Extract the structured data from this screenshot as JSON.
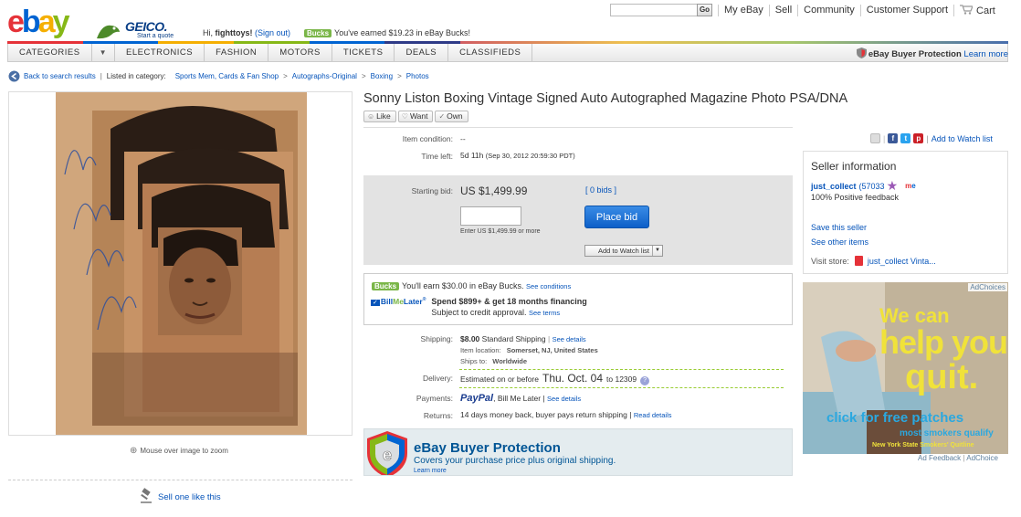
{
  "header": {
    "greeting_prefix": "Hi,",
    "username": "fighttoys!",
    "signout": "(Sign out)",
    "bucks_badge": "Bucks",
    "bucks_text": "You've earned $19.23 in eBay Bucks!",
    "geico_brand": "GEICO.",
    "geico_sub": "Start a quote",
    "go_label": "Go",
    "nav": [
      "My eBay",
      "Sell",
      "Community",
      "Customer Support",
      "Cart"
    ]
  },
  "categories": [
    "CATEGORIES",
    "ELECTRONICS",
    "FASHION",
    "MOTORS",
    "TICKETS",
    "DEALS",
    "CLASSIFIEDS"
  ],
  "protection_top": {
    "label": "eBay Buyer Protection",
    "learn": "Learn more"
  },
  "breadcrumb": {
    "back": "Back to search results",
    "listed": "Listed in category:",
    "crumbs": [
      "Sports Mem, Cards & Fan Shop",
      "Autographs-Original",
      "Boxing",
      "Photos"
    ]
  },
  "left": {
    "zoom_text": "Mouse over image to zoom",
    "sell_one": "Sell one like this"
  },
  "item": {
    "title": "Sonny Liston Boxing Vintage Signed Auto Autographed Magazine Photo PSA/DNA",
    "like_buttons": [
      "Like",
      "Want",
      "Own"
    ],
    "condition_label": "Item condition:",
    "condition_value": "--",
    "time_left_label": "Time left:",
    "time_left_value": "5d 11h",
    "time_left_end": "(Sep 30, 2012  20:59:30 PDT)",
    "starting_bid_label": "Starting bid:",
    "starting_bid_value": "US $1,499.99",
    "bids": "[ 0 bids ]",
    "bid_hint": "Enter US $1,499.99 or more",
    "place_bid": "Place bid",
    "add_watch": "Add to Watch list",
    "social_watch": "Add to Watch list",
    "bucks_earn": "You'll earn $30.00 in eBay Bucks.",
    "see_conditions": "See conditions",
    "bml_offer": "Spend $899+ & get 18 months financing",
    "bml_sub": "Subject to credit approval.",
    "see_terms": "See terms",
    "shipping_label": "Shipping:",
    "shipping_cost": "$8.00",
    "shipping_method": "Standard Shipping",
    "see_details": "See details",
    "item_location_label": "Item location:",
    "item_location": "Somerset, NJ, United States",
    "ships_to_label": "Ships to:",
    "ships_to": "Worldwide",
    "delivery_label": "Delivery:",
    "delivery_prefix": "Estimated on or before",
    "delivery_date": "Thu. Oct. 04",
    "delivery_zip": "to 12309",
    "payments_label": "Payments:",
    "paypal": "PayPal",
    "payments_other": ", Bill Me Later |",
    "payments_details": "See details",
    "returns_label": "Returns:",
    "returns_value": "14 days money back, buyer pays return shipping |",
    "read_details": "Read details"
  },
  "promo": {
    "title": "eBay Buyer Protection",
    "subtitle": "Covers your purchase price plus original shipping.",
    "learn": "Learn more"
  },
  "seller": {
    "heading": "Seller information",
    "name": "just_collect",
    "score": "(57033",
    "feedback": "100% Positive feedback",
    "save": "Save this seller",
    "other_items": "See other items",
    "visit_store_label": "Visit store:",
    "store_name": "just_collect Vinta..."
  },
  "ad": {
    "adchoices": "AdChoices",
    "line1": "We can",
    "line2": "help you",
    "line3": "quit.",
    "cta": "click for free patches",
    "note": "most smokers qualify",
    "org": "New York State Smokers' Quitline",
    "feedback": "Ad Feedback",
    "choice": "AdChoice"
  },
  "colors": {
    "link": "#0654ba",
    "bid_button": "#0d5fc8",
    "bucks_green": "#7ab648"
  }
}
